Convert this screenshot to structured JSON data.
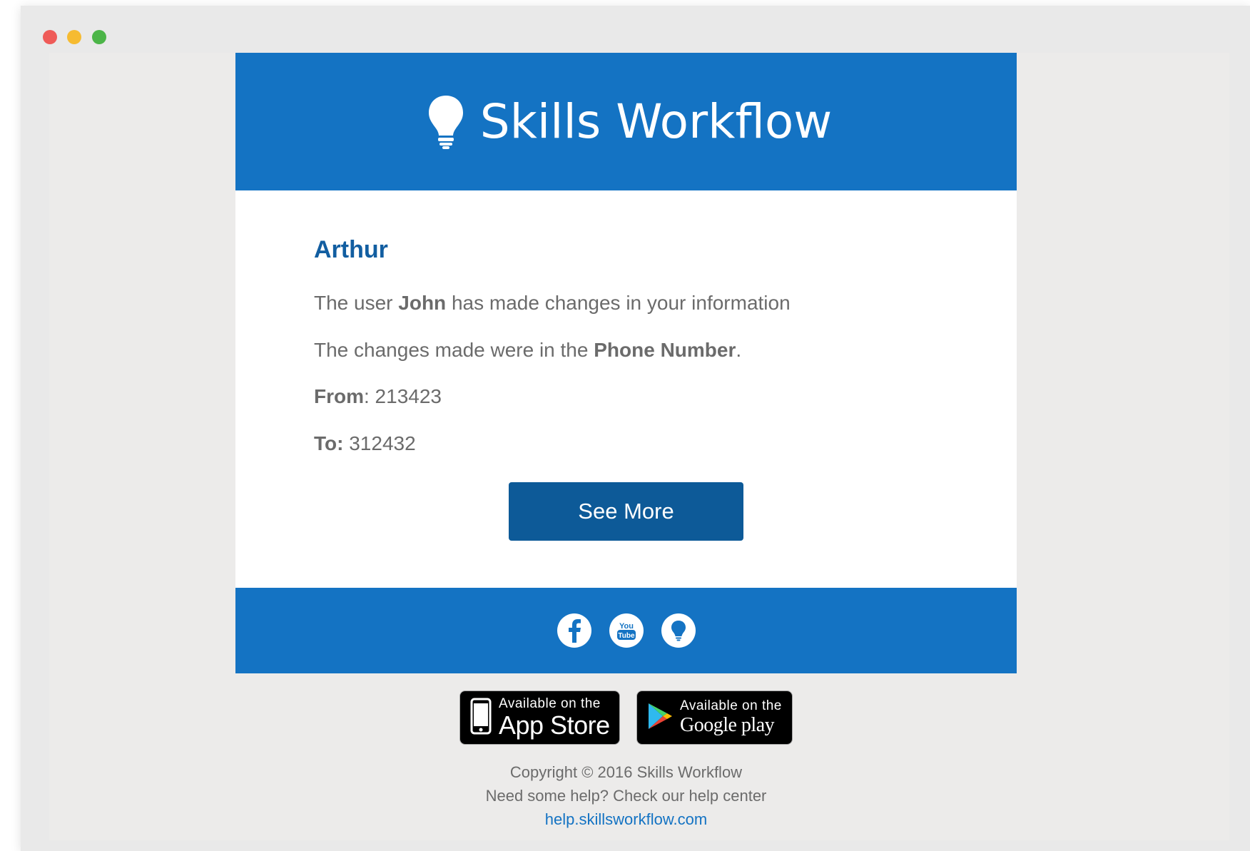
{
  "window": {
    "controls": [
      "close",
      "minimize",
      "maximize"
    ]
  },
  "email": {
    "brand": {
      "name": "Skills Workflow",
      "icon": "lightbulb-icon",
      "header_color": "#1473c3"
    },
    "greeting": "Arthur",
    "lines": {
      "user_prefix": "The user ",
      "user_name": "John",
      "user_suffix": " has made changes in your information",
      "changes_prefix": "The changes made were in the ",
      "changes_field": "Phone Number",
      "changes_suffix": ".",
      "from_label": "From",
      "from_value": ": 213423",
      "to_label": "To:",
      "to_value": " 312432"
    },
    "cta_label": "See More",
    "cta_color": "#0d5a98",
    "social": [
      "facebook-icon",
      "youtube-icon",
      "lightbulb-icon"
    ],
    "stores": {
      "apple_small": "Available on the",
      "apple_big": "App Store",
      "google_small": "Available on the",
      "google_big": "Google play"
    },
    "footer": {
      "copyright": "Copyright © 2016 Skills Workflow",
      "help_text": "Need some help? Check our help center",
      "help_link": "help.skillsworkflow.com"
    }
  }
}
